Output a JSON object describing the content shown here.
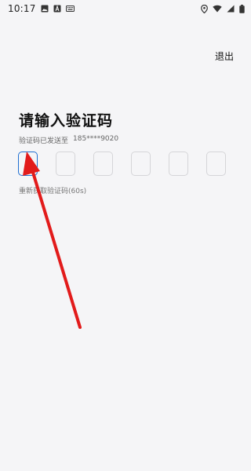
{
  "status_bar": {
    "time": "10:17"
  },
  "header": {
    "logout_label": "退出"
  },
  "main": {
    "title": "请输入验证码",
    "sent_to_label": "验证码已发送至",
    "phone_masked": "185****9020",
    "resend_label": "重新获取验证码(60s)"
  },
  "code_input": {
    "length": 6,
    "active_index": 0
  },
  "colors": {
    "active_border": "#1f6fd1",
    "arrow": "#e21b1b"
  }
}
